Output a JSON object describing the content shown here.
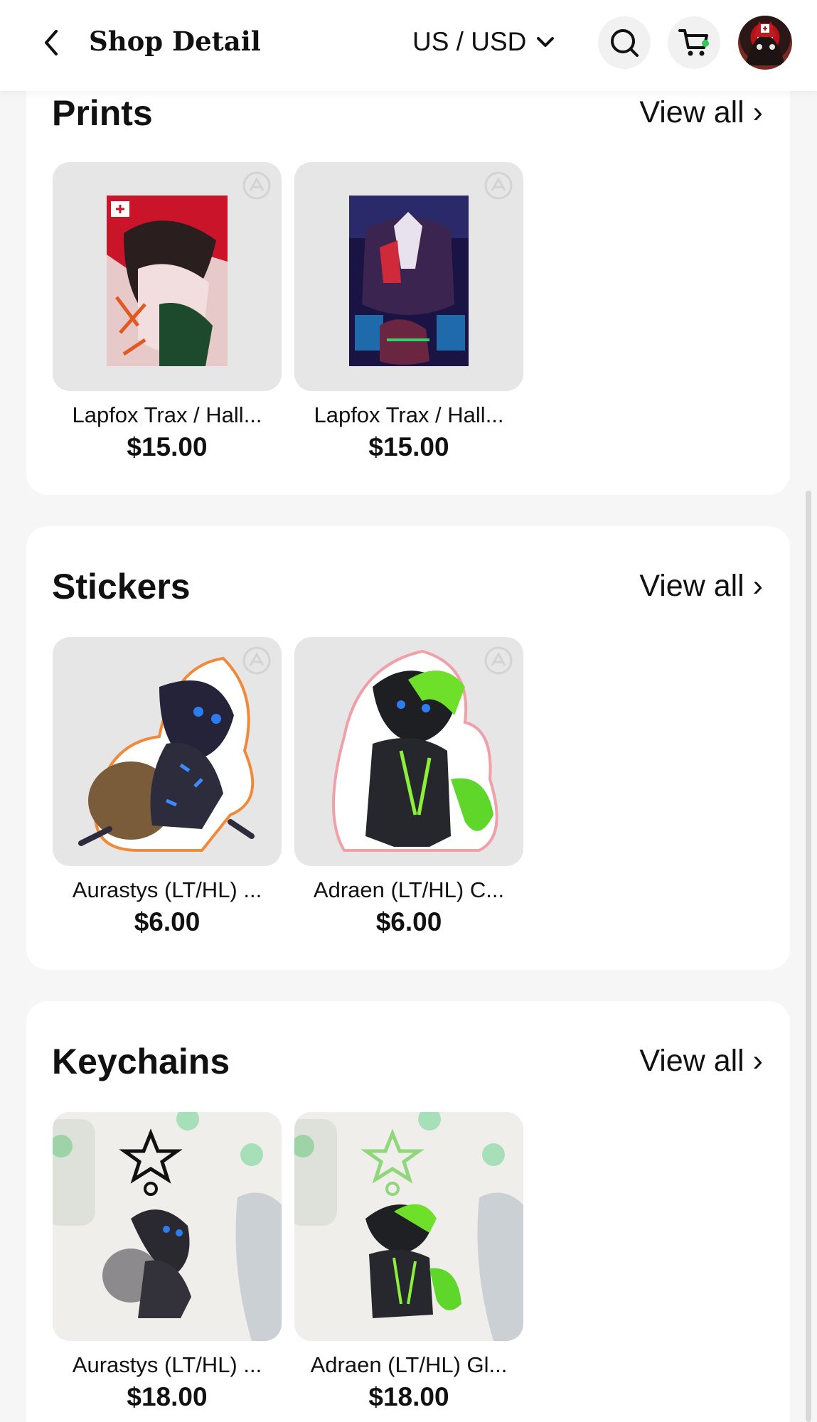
{
  "header": {
    "title": "Shop Detail",
    "currency": "US / USD"
  },
  "sections": [
    {
      "title": "Prints",
      "view_all": "View all ›",
      "items": [
        {
          "name": "Lapfox Trax / Hall...",
          "price": "$15.00"
        },
        {
          "name": "Lapfox Trax / Hall...",
          "price": "$15.00"
        }
      ]
    },
    {
      "title": "Stickers",
      "view_all": "View all ›",
      "items": [
        {
          "name": "Aurastys (LT/HL) ...",
          "price": "$6.00"
        },
        {
          "name": "Adraen (LT/HL) C...",
          "price": "$6.00"
        }
      ]
    },
    {
      "title": "Keychains",
      "view_all": "View all ›",
      "items": [
        {
          "name": "Aurastys (LT/HL) ...",
          "price": "$18.00"
        },
        {
          "name": "Adraen (LT/HL) Gl...",
          "price": "$18.00"
        }
      ]
    }
  ],
  "icons": {
    "back": "back-arrow-icon",
    "dropdown": "chevron-down-icon",
    "search": "search-icon",
    "cart": "cart-icon",
    "badge": "artist-badge-icon"
  },
  "colors": {
    "background": "#f6f6f7",
    "card": "#ffffff",
    "thumb_bg": "#e6e6e7",
    "cart_dot": "#35c759"
  }
}
